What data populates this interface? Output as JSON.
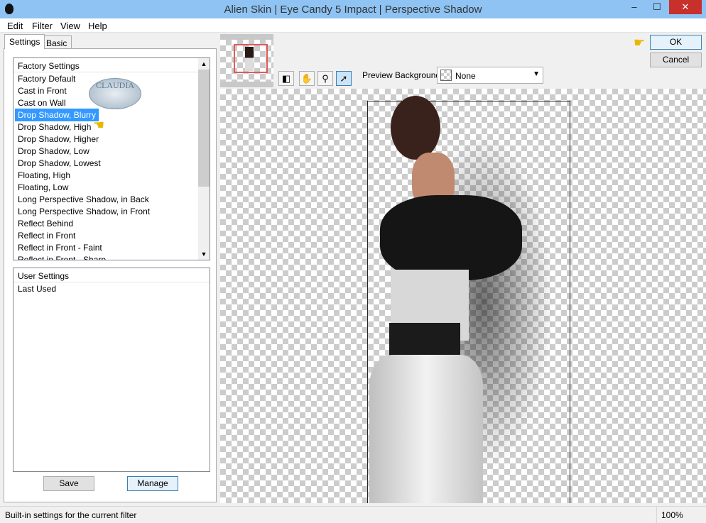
{
  "window": {
    "title": "Alien Skin | Eye Candy 5 Impact | Perspective Shadow",
    "minimize": "–",
    "maximize": "☐",
    "close": "✕"
  },
  "menu": [
    "Edit",
    "Filter",
    "View",
    "Help"
  ],
  "tabs": [
    "Settings",
    "Basic"
  ],
  "factory": {
    "header": "Factory Settings",
    "items": [
      "Factory Default",
      "Cast in Front",
      "Cast on Wall",
      "Drop Shadow, Blurry",
      "Drop Shadow, High",
      "Drop Shadow, Higher",
      "Drop Shadow, Low",
      "Drop Shadow, Lowest",
      "Floating, High",
      "Floating, Low",
      "Long Perspective Shadow, in Back",
      "Long Perspective Shadow, in Front",
      "Reflect Behind",
      "Reflect in Front",
      "Reflect in Front - Faint",
      "Reflect in Front - Sharp"
    ],
    "selected": "Drop Shadow, Blurry"
  },
  "user": {
    "header": "User Settings",
    "items": [
      "Last Used"
    ]
  },
  "buttons": {
    "save": "Save",
    "manage": "Manage",
    "ok": "OK",
    "cancel": "Cancel"
  },
  "preview": {
    "label": "Preview Background:",
    "value": "None"
  },
  "watermark": "CLAUDIA",
  "status": {
    "text": "Built-in settings for the current filter",
    "zoom": "100%"
  },
  "colors": {
    "selection": "#3399ff",
    "titlebar": "#8ec3f3",
    "pointer": "#e8b800"
  }
}
